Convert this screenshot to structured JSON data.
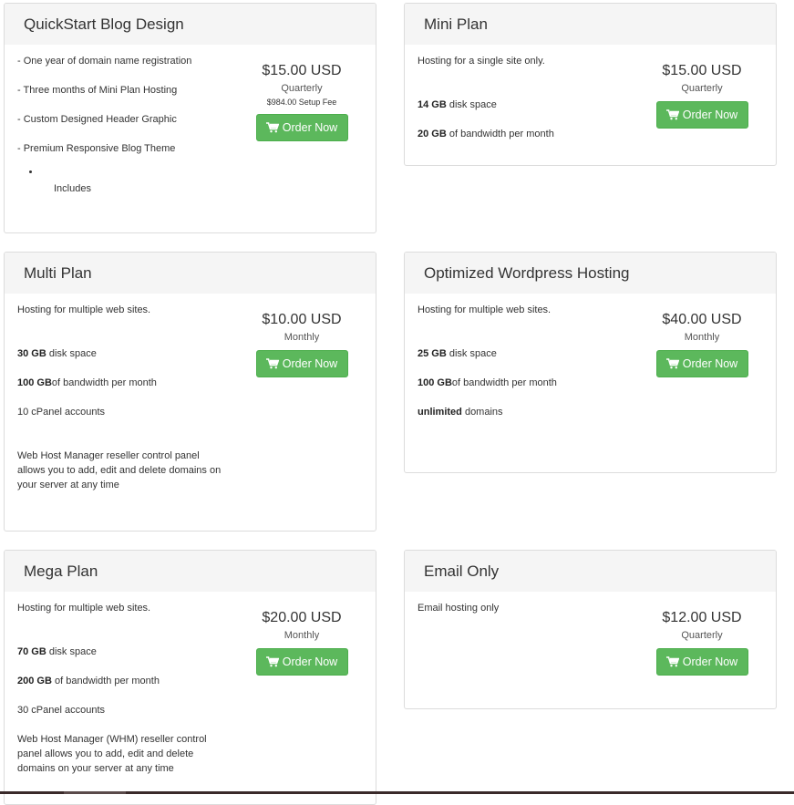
{
  "order_label": "Order Now",
  "plans": {
    "quickstart": {
      "title": "QuickStart Blog Design",
      "features": [
        "- One year of domain name registration",
        "- Three months of Mini Plan Hosting",
        "- Custom Designed Header Graphic",
        "- Premium Responsive Blog Theme"
      ],
      "includes": "Includes",
      "price": "$15.00 USD",
      "cycle": "Quarterly",
      "setup_fee": "$984.00 Setup Fee"
    },
    "mini": {
      "title": "Mini Plan",
      "intro": "Hosting for a single site only.",
      "disk_bold": "14 GB",
      "disk_rest": " disk space",
      "bw_bold": "20 GB",
      "bw_rest": " of bandwidth per month",
      "price": "$15.00 USD",
      "cycle": "Quarterly"
    },
    "multi": {
      "title": "Multi Plan",
      "intro": "Hosting for multiple web sites.",
      "disk_bold": "30 GB",
      "disk_rest": " disk space",
      "bw_bold": "100 GB",
      "bw_rest": "of bandwidth per month",
      "cpanel": "10 cPanel accounts",
      "whm": "Web Host Manager reseller control panel allows you to add, edit and delete domains on your server at any time",
      "price": "$10.00 USD",
      "cycle": "Monthly"
    },
    "wordpress": {
      "title": "Optimized Wordpress Hosting",
      "intro": "Hosting for multiple web sites.",
      "disk_bold": "25 GB",
      "disk_rest": " disk space",
      "bw_bold": "100 GB",
      "bw_rest": "of bandwidth per month",
      "domains_bold": "unlimited",
      "domains_rest": " domains",
      "price": "$40.00 USD",
      "cycle": "Monthly"
    },
    "mega": {
      "title": "Mega Plan",
      "intro": "Hosting for multiple web sites.",
      "disk_bold": "70 GB",
      "disk_rest": " disk space",
      "bw_bold": "200 GB",
      "bw_rest": " of bandwidth per month",
      "cpanel": "30 cPanel accounts",
      "whm": "Web Host Manager (WHM) reseller control panel allows you to add, edit and delete domains on your server at any time",
      "price": "$20.00 USD",
      "cycle": "Monthly"
    },
    "email": {
      "title": "Email Only",
      "intro": "Email hosting only",
      "price": "$12.00 USD",
      "cycle": "Quarterly"
    }
  },
  "colors": {
    "button": "#5cb85c",
    "header_bg": "#f5f5f5",
    "border": "#dcdcdc"
  },
  "icons": {
    "order": "shopping-cart-icon"
  }
}
